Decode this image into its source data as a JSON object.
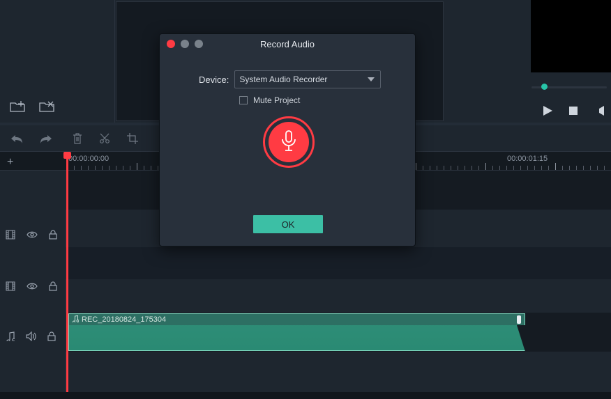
{
  "modal": {
    "title": "Record Audio",
    "device_label": "Device:",
    "device_value": "System Audio Recorder",
    "mute_label": "Mute Project",
    "mute_checked": false,
    "ok_label": "OK"
  },
  "timeline": {
    "tc0": "00:00:00:00",
    "tc1": "00:00:01:15",
    "clip_name": "REC_20180824_175304"
  },
  "icons": {
    "folder_add": "folder-add-icon",
    "folder_remove": "folder-remove-icon",
    "undo": "undo-icon",
    "redo": "redo-icon",
    "trash": "trash-icon",
    "scissors": "scissors-icon",
    "crop": "crop-icon",
    "plus": "plus-icon",
    "film": "film-icon",
    "eye": "eye-icon",
    "lock": "lock-icon",
    "music": "music-icon",
    "speaker": "speaker-icon",
    "play": "play-icon",
    "stop": "stop-icon",
    "speaker_off": "speaker-off-icon",
    "mic": "microphone-icon",
    "close": "close-icon",
    "min": "minimize-icon",
    "max": "maximize-icon"
  }
}
